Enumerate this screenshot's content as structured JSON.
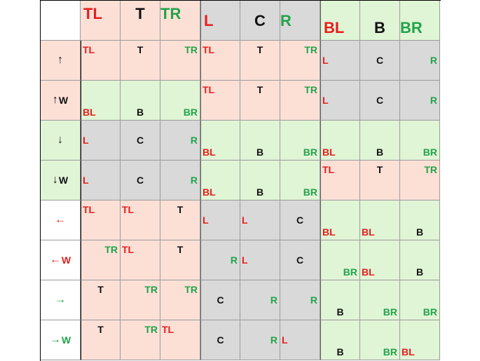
{
  "colors": {
    "salmon": "#fce0d6",
    "gray": "#d9d9d9",
    "green": "#e0f5d5",
    "white": "#ffffff",
    "red": "#e61e1e",
    "black": "#111111",
    "dgreen": "#22a34a"
  },
  "headers": [
    {
      "text": "TL",
      "bg": "salmon",
      "color": "red",
      "pos": "tl"
    },
    {
      "text": "T",
      "bg": "salmon",
      "color": "black",
      "pos": "tc"
    },
    {
      "text": "TR",
      "bg": "salmon",
      "color": "dgreen",
      "pos": "tr"
    },
    {
      "text": "L",
      "bg": "gray",
      "color": "red",
      "pos": "ml"
    },
    {
      "text": "C",
      "bg": "gray",
      "color": "black",
      "pos": "mc"
    },
    {
      "text": "R",
      "bg": "gray",
      "color": "dgreen",
      "pos": "mr"
    },
    {
      "text": "BL",
      "bg": "green",
      "color": "red",
      "pos": "bl"
    },
    {
      "text": "B",
      "bg": "green",
      "color": "black",
      "pos": "bc"
    },
    {
      "text": "BR",
      "bg": "green",
      "color": "dgreen",
      "pos": "br"
    }
  ],
  "rows": [
    {
      "arrow": "↑",
      "w": "",
      "arrow_color": "black",
      "bg": "salmon",
      "cells": [
        {
          "bg": "salmon",
          "tags": [
            {
              "t": "TL",
              "c": "red",
              "p": "tl"
            }
          ]
        },
        {
          "bg": "salmon",
          "tags": [
            {
              "t": "T",
              "c": "black",
              "p": "tc"
            }
          ]
        },
        {
          "bg": "salmon",
          "tags": [
            {
              "t": "TR",
              "c": "dgreen",
              "p": "tr"
            }
          ]
        },
        {
          "bg": "salmon",
          "tags": [
            {
              "t": "TL",
              "c": "red",
              "p": "tl"
            }
          ]
        },
        {
          "bg": "salmon",
          "tags": [
            {
              "t": "T",
              "c": "black",
              "p": "tc"
            }
          ]
        },
        {
          "bg": "salmon",
          "tags": [
            {
              "t": "TR",
              "c": "dgreen",
              "p": "tr"
            }
          ]
        },
        {
          "bg": "gray",
          "tags": [
            {
              "t": "L",
              "c": "red",
              "p": "ml"
            }
          ]
        },
        {
          "bg": "gray",
          "tags": [
            {
              "t": "C",
              "c": "black",
              "p": "mc"
            }
          ]
        },
        {
          "bg": "gray",
          "tags": [
            {
              "t": "R",
              "c": "dgreen",
              "p": "mr"
            }
          ]
        }
      ]
    },
    {
      "arrow": "↑",
      "w": "W",
      "arrow_color": "black",
      "bg": "salmon",
      "cells": [
        {
          "bg": "green",
          "tags": [
            {
              "t": "BL",
              "c": "red",
              "p": "bl"
            }
          ]
        },
        {
          "bg": "green",
          "tags": [
            {
              "t": "B",
              "c": "black",
              "p": "bc"
            }
          ]
        },
        {
          "bg": "green",
          "tags": [
            {
              "t": "BR",
              "c": "dgreen",
              "p": "br"
            }
          ]
        },
        {
          "bg": "salmon",
          "tags": [
            {
              "t": "TL",
              "c": "red",
              "p": "tl"
            }
          ]
        },
        {
          "bg": "salmon",
          "tags": [
            {
              "t": "T",
              "c": "black",
              "p": "tc"
            }
          ]
        },
        {
          "bg": "salmon",
          "tags": [
            {
              "t": "TR",
              "c": "dgreen",
              "p": "tr"
            }
          ]
        },
        {
          "bg": "gray",
          "tags": [
            {
              "t": "L",
              "c": "red",
              "p": "ml"
            }
          ]
        },
        {
          "bg": "gray",
          "tags": [
            {
              "t": "C",
              "c": "black",
              "p": "mc"
            }
          ]
        },
        {
          "bg": "gray",
          "tags": [
            {
              "t": "R",
              "c": "dgreen",
              "p": "mr"
            }
          ]
        }
      ]
    },
    {
      "arrow": "↓",
      "w": "",
      "arrow_color": "black",
      "bg": "green",
      "cells": [
        {
          "bg": "gray",
          "tags": [
            {
              "t": "L",
              "c": "red",
              "p": "ml"
            }
          ]
        },
        {
          "bg": "gray",
          "tags": [
            {
              "t": "C",
              "c": "black",
              "p": "mc"
            }
          ]
        },
        {
          "bg": "gray",
          "tags": [
            {
              "t": "R",
              "c": "dgreen",
              "p": "mr"
            }
          ]
        },
        {
          "bg": "green",
          "tags": [
            {
              "t": "BL",
              "c": "red",
              "p": "bl"
            }
          ]
        },
        {
          "bg": "green",
          "tags": [
            {
              "t": "B",
              "c": "black",
              "p": "bc"
            }
          ]
        },
        {
          "bg": "green",
          "tags": [
            {
              "t": "BR",
              "c": "dgreen",
              "p": "br"
            }
          ]
        },
        {
          "bg": "green",
          "tags": [
            {
              "t": "BL",
              "c": "red",
              "p": "bl"
            }
          ]
        },
        {
          "bg": "green",
          "tags": [
            {
              "t": "B",
              "c": "black",
              "p": "bc"
            }
          ]
        },
        {
          "bg": "green",
          "tags": [
            {
              "t": "BR",
              "c": "dgreen",
              "p": "br"
            }
          ]
        }
      ]
    },
    {
      "arrow": "↓",
      "w": "W",
      "arrow_color": "black",
      "bg": "green",
      "cells": [
        {
          "bg": "gray",
          "tags": [
            {
              "t": "L",
              "c": "red",
              "p": "ml"
            }
          ]
        },
        {
          "bg": "gray",
          "tags": [
            {
              "t": "C",
              "c": "black",
              "p": "mc"
            }
          ]
        },
        {
          "bg": "gray",
          "tags": [
            {
              "t": "R",
              "c": "dgreen",
              "p": "mr"
            }
          ]
        },
        {
          "bg": "green",
          "tags": [
            {
              "t": "BL",
              "c": "red",
              "p": "bl"
            }
          ]
        },
        {
          "bg": "green",
          "tags": [
            {
              "t": "B",
              "c": "black",
              "p": "bc"
            }
          ]
        },
        {
          "bg": "green",
          "tags": [
            {
              "t": "BR",
              "c": "dgreen",
              "p": "br"
            }
          ]
        },
        {
          "bg": "salmon",
          "tags": [
            {
              "t": "TL",
              "c": "red",
              "p": "tl"
            }
          ]
        },
        {
          "bg": "salmon",
          "tags": [
            {
              "t": "T",
              "c": "black",
              "p": "tc"
            }
          ]
        },
        {
          "bg": "salmon",
          "tags": [
            {
              "t": "TR",
              "c": "dgreen",
              "p": "tr"
            }
          ]
        }
      ]
    },
    {
      "arrow": "←",
      "w": "",
      "arrow_color": "red",
      "bg": "white",
      "cells": [
        {
          "bg": "salmon",
          "tags": [
            {
              "t": "TL",
              "c": "red",
              "p": "tl"
            }
          ]
        },
        {
          "bg": "salmon",
          "tags": [
            {
              "t": "TL",
              "c": "red",
              "p": "tl"
            }
          ]
        },
        {
          "bg": "salmon",
          "tags": [
            {
              "t": "T",
              "c": "black",
              "p": "tc"
            }
          ]
        },
        {
          "bg": "gray",
          "tags": [
            {
              "t": "L",
              "c": "red",
              "p": "ml"
            }
          ]
        },
        {
          "bg": "gray",
          "tags": [
            {
              "t": "L",
              "c": "red",
              "p": "ml"
            }
          ]
        },
        {
          "bg": "gray",
          "tags": [
            {
              "t": "C",
              "c": "black",
              "p": "mc"
            }
          ]
        },
        {
          "bg": "green",
          "tags": [
            {
              "t": "BL",
              "c": "red",
              "p": "bl"
            }
          ]
        },
        {
          "bg": "green",
          "tags": [
            {
              "t": "BL",
              "c": "red",
              "p": "bl"
            }
          ]
        },
        {
          "bg": "green",
          "tags": [
            {
              "t": "B",
              "c": "black",
              "p": "bc"
            }
          ]
        }
      ]
    },
    {
      "arrow": "←",
      "w": "W",
      "arrow_color": "red",
      "bg": "white",
      "cells": [
        {
          "bg": "salmon",
          "tags": [
            {
              "t": "TR",
              "c": "dgreen",
              "p": "tr"
            }
          ]
        },
        {
          "bg": "salmon",
          "tags": [
            {
              "t": "TL",
              "c": "red",
              "p": "tl"
            }
          ]
        },
        {
          "bg": "salmon",
          "tags": [
            {
              "t": "T",
              "c": "black",
              "p": "tc"
            }
          ]
        },
        {
          "bg": "gray",
          "tags": [
            {
              "t": "R",
              "c": "dgreen",
              "p": "mr"
            }
          ]
        },
        {
          "bg": "gray",
          "tags": [
            {
              "t": "L",
              "c": "red",
              "p": "ml"
            }
          ]
        },
        {
          "bg": "gray",
          "tags": [
            {
              "t": "C",
              "c": "black",
              "p": "mc"
            }
          ]
        },
        {
          "bg": "green",
          "tags": [
            {
              "t": "BR",
              "c": "dgreen",
              "p": "br"
            }
          ]
        },
        {
          "bg": "green",
          "tags": [
            {
              "t": "BL",
              "c": "red",
              "p": "bl"
            }
          ]
        },
        {
          "bg": "green",
          "tags": [
            {
              "t": "B",
              "c": "black",
              "p": "bc"
            }
          ]
        }
      ]
    },
    {
      "arrow": "→",
      "w": "",
      "arrow_color": "dgreen",
      "bg": "white",
      "cells": [
        {
          "bg": "salmon",
          "tags": [
            {
              "t": "T",
              "c": "black",
              "p": "tc"
            }
          ]
        },
        {
          "bg": "salmon",
          "tags": [
            {
              "t": "TR",
              "c": "dgreen",
              "p": "tr"
            }
          ]
        },
        {
          "bg": "salmon",
          "tags": [
            {
              "t": "TR",
              "c": "dgreen",
              "p": "tr"
            }
          ]
        },
        {
          "bg": "gray",
          "tags": [
            {
              "t": "C",
              "c": "black",
              "p": "mc"
            }
          ]
        },
        {
          "bg": "gray",
          "tags": [
            {
              "t": "R",
              "c": "dgreen",
              "p": "mr"
            }
          ]
        },
        {
          "bg": "gray",
          "tags": [
            {
              "t": "R",
              "c": "dgreen",
              "p": "mr"
            }
          ]
        },
        {
          "bg": "green",
          "tags": [
            {
              "t": "B",
              "c": "black",
              "p": "bc"
            }
          ]
        },
        {
          "bg": "green",
          "tags": [
            {
              "t": "BR",
              "c": "dgreen",
              "p": "br"
            }
          ]
        },
        {
          "bg": "green",
          "tags": [
            {
              "t": "BR",
              "c": "dgreen",
              "p": "br"
            }
          ]
        }
      ]
    },
    {
      "arrow": "→",
      "w": "W",
      "arrow_color": "dgreen",
      "bg": "white",
      "cells": [
        {
          "bg": "salmon",
          "tags": [
            {
              "t": "T",
              "c": "black",
              "p": "tc"
            }
          ]
        },
        {
          "bg": "salmon",
          "tags": [
            {
              "t": "TR",
              "c": "dgreen",
              "p": "tr"
            }
          ]
        },
        {
          "bg": "salmon",
          "tags": [
            {
              "t": "TL",
              "c": "red",
              "p": "tl"
            }
          ]
        },
        {
          "bg": "gray",
          "tags": [
            {
              "t": "C",
              "c": "black",
              "p": "mc"
            }
          ]
        },
        {
          "bg": "gray",
          "tags": [
            {
              "t": "R",
              "c": "dgreen",
              "p": "mr"
            }
          ]
        },
        {
          "bg": "gray",
          "tags": [
            {
              "t": "L",
              "c": "red",
              "p": "ml"
            }
          ]
        },
        {
          "bg": "green",
          "tags": [
            {
              "t": "B",
              "c": "black",
              "p": "bc"
            }
          ]
        },
        {
          "bg": "green",
          "tags": [
            {
              "t": "BR",
              "c": "dgreen",
              "p": "br"
            }
          ]
        },
        {
          "bg": "green",
          "tags": [
            {
              "t": "BL",
              "c": "red",
              "p": "bl"
            }
          ]
        }
      ]
    }
  ]
}
